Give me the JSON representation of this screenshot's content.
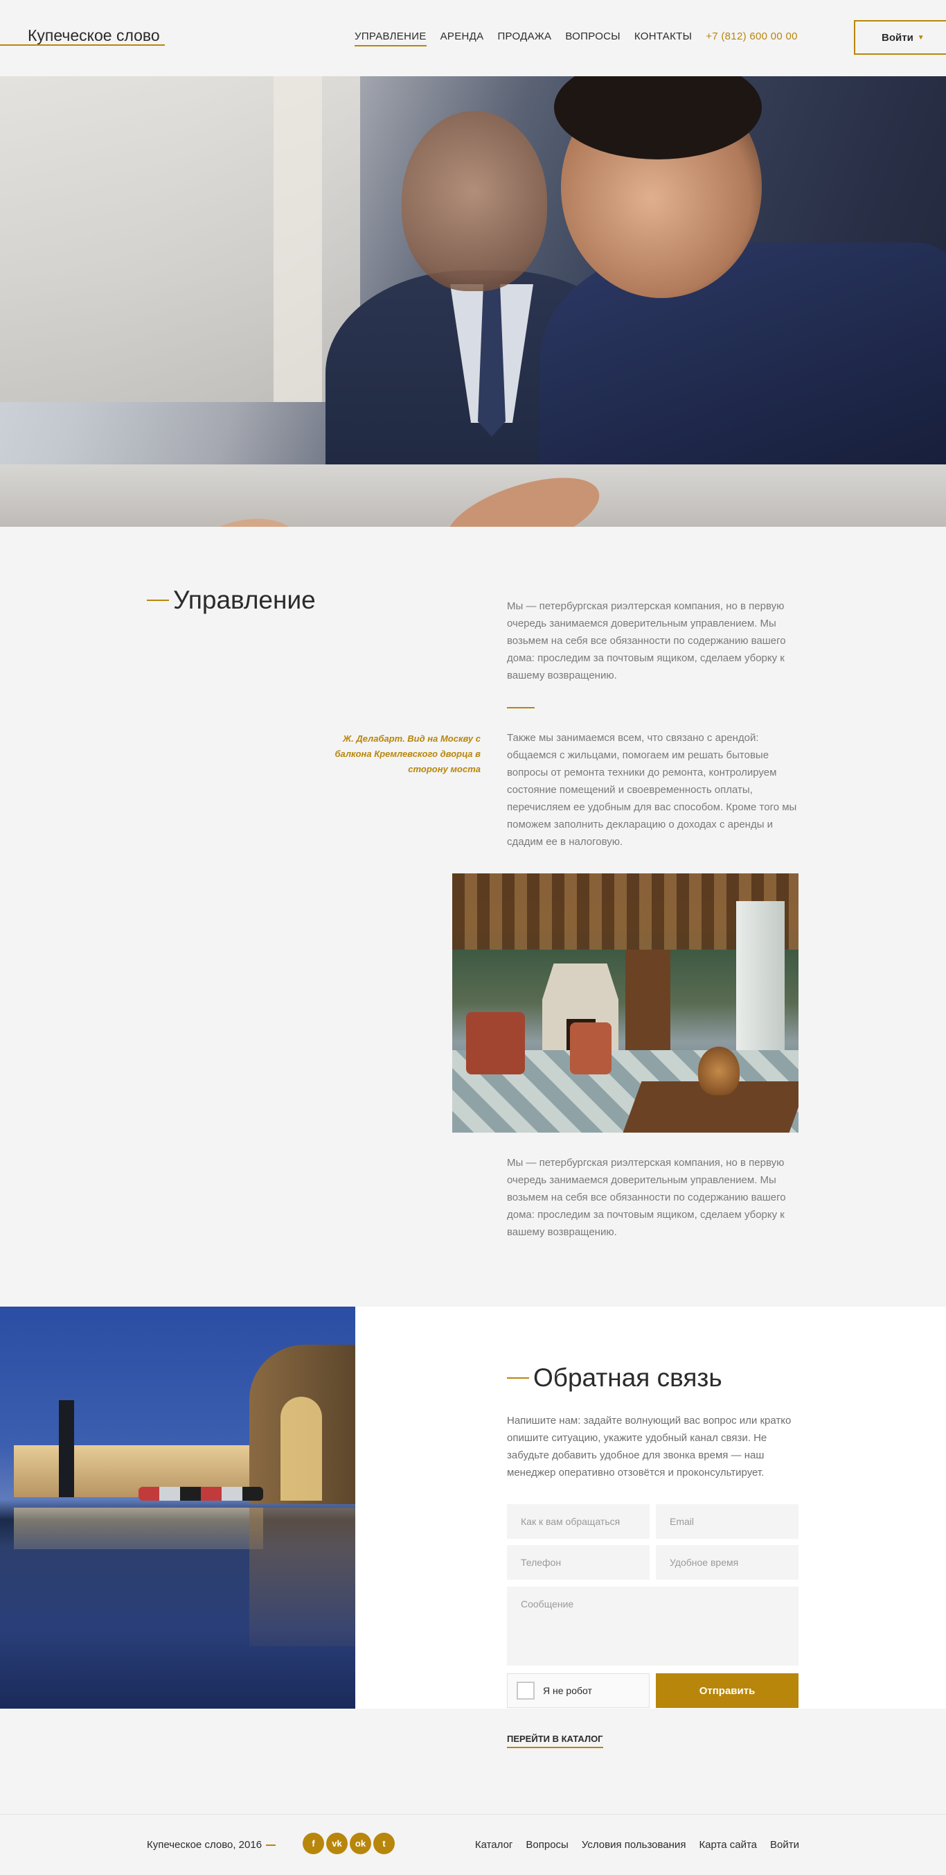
{
  "header": {
    "logo": "Купеческое слово",
    "nav": [
      {
        "label": "УПРАВЛЕНИЕ",
        "active": true
      },
      {
        "label": "АРЕНДА",
        "active": false
      },
      {
        "label": "ПРОДАЖА",
        "active": false
      },
      {
        "label": "ВОПРОСЫ",
        "active": false
      },
      {
        "label": "КОНТАКТЫ",
        "active": false
      }
    ],
    "phone": "+7 (812) 600 00 00",
    "login_label": "Войти"
  },
  "management": {
    "title": "Управление",
    "paragraph1": "Мы — петербургская риэлтерская компания, но в первую очередь занимаемся доверительным управлением. Мы возьмем на себя все обязанности по содержанию вашего дома: проследим за почтовым ящиком, сделаем уборку к вашему возвращению.",
    "caption": "Ж. Делабарт. Вид на Москву с балкона Кремлевского дворца в сторону моста",
    "paragraph2": "Также мы занимаемся всем, что связано с арендой: общаемся с жильцами, помогаем им решать бытовые вопросы от ремонта техники до ремонта, контролируем состояние помещений и своевременность оплаты, перечисляем ее удобным для вас способом. Кроме того мы поможем заполнить декларацию о доходах с аренды и сдадим ее в налоговую.",
    "paragraph3": "Мы — петербургская риэлтерская компания, но в первую очередь занимаемся доверительным управлением. Мы возьмем на себя все обязанности по содержанию вашего дома: проследим за почтовым ящиком, сделаем уборку к вашему возвращению."
  },
  "feedback": {
    "title": "Обратная связь",
    "text": "Напишите нам: задайте волнующий вас вопрос или кратко опишите ситуацию, укажите удобный канал связи. Не забудьте добавить удобное для звонка время — наш менеджер оперативно отзовётся и проконсультирует.",
    "name_placeholder": "Как к вам обращаться",
    "email_placeholder": "Email",
    "phone_placeholder": "Телефон",
    "time_placeholder": "Удобное время",
    "message_placeholder": "Сообщение",
    "captcha_label": "Я не робот",
    "submit_label": "Отправить",
    "catalog_link": "ПЕРЕЙТИ В КАТАЛОГ"
  },
  "footer": {
    "copyright": "Купеческое слово, 2016",
    "socials": [
      {
        "icon": "facebook-icon",
        "glyph": "f"
      },
      {
        "icon": "vk-icon",
        "glyph": "vk"
      },
      {
        "icon": "odnoklassniki-icon",
        "glyph": "ok"
      },
      {
        "icon": "twitter-icon",
        "glyph": "t"
      }
    ],
    "links": [
      "Каталог",
      "Вопросы",
      "Условия пользования",
      "Карта сайта",
      "Войти"
    ]
  },
  "colors": {
    "accent": "#b8860b",
    "background": "#f4f4f4",
    "text": "#2b2b2b",
    "muted_text": "#7a7a7a"
  }
}
